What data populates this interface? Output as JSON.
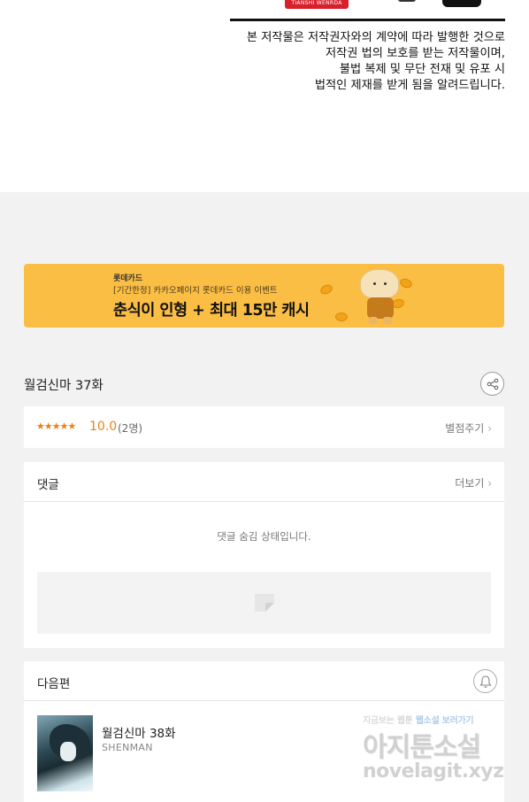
{
  "top_art": {
    "red_tag_text": "TIANSHI WENRDA"
  },
  "copyright_notice": [
    "본 저작물은 저작권자와의 계약에 따라 발행한 것으로",
    "저작권 법의 보호를 받는 저작물이며,",
    "불법 복제 및 무단 전재 및 유포 시",
    "법적인 제재를 받게 됨을 알려드립니다."
  ],
  "banner": {
    "brand": "롯데카드",
    "subtitle": "[기간한정] 카카오페이지 롯데카드 이용 이벤트",
    "headline": "춘식이 인형 + 최대 15만 캐시",
    "color": "#fbbe45"
  },
  "episode": {
    "title": "월검신마 37화",
    "share_icon": "share-icon"
  },
  "rating": {
    "stars": "★★★★★",
    "score": "10.0",
    "count": "(2명)",
    "rate_label": "별점주기",
    "accent": "#e8821a"
  },
  "comments": {
    "title": "댓글",
    "more_label": "더보기",
    "hidden_message": "댓글 숨김 상태입니다."
  },
  "next_episode": {
    "section_title": "다음편",
    "title": "월검신마 38화",
    "author": "SHENMAN",
    "bell_icon": "bell-icon"
  },
  "watermark": {
    "tagline_a": "지금보는 웹툰",
    "tagline_b": "웹소설 보러가기",
    "brand": "아지툰소설",
    "url": "novelagit.xyz"
  }
}
